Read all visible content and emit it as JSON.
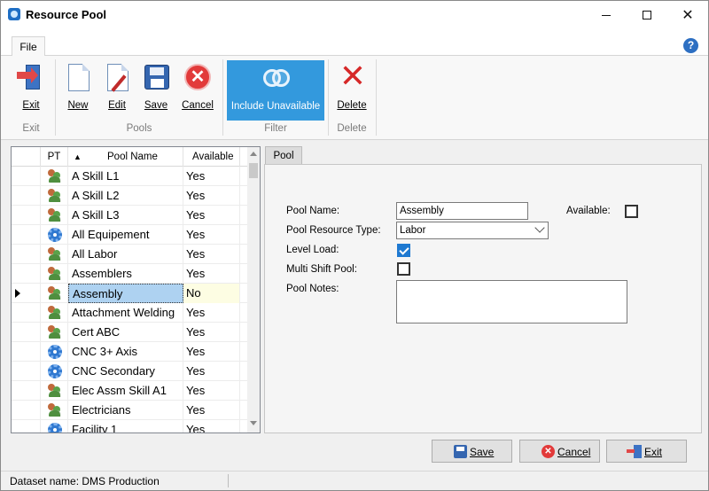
{
  "window": {
    "title": "Resource Pool"
  },
  "ribbon": {
    "tab": "File",
    "buttons": {
      "exit": "Exit",
      "new": "New",
      "edit": "Edit",
      "save": "Save",
      "cancel": "Cancel",
      "include_unavailable": "Include Unavailable",
      "delete": "Delete"
    },
    "groups": {
      "exit": "Exit",
      "pools": "Pools",
      "filter": "Filter",
      "delete": "Delete"
    }
  },
  "grid": {
    "headers": {
      "pt": "PT",
      "sort": "▲",
      "name": "Pool Name",
      "available": "Available"
    },
    "rows": [
      {
        "type": "people-icon",
        "name": "A Skill L1",
        "available": "Yes"
      },
      {
        "type": "people-icon",
        "name": "A Skill L2",
        "available": "Yes"
      },
      {
        "type": "people-icon",
        "name": "A Skill L3",
        "available": "Yes"
      },
      {
        "type": "gear-icon",
        "name": "All Equipement",
        "available": "Yes"
      },
      {
        "type": "people-icon",
        "name": "All Labor",
        "available": "Yes"
      },
      {
        "type": "people-icon",
        "name": "Assemblers",
        "available": "Yes"
      },
      {
        "type": "people-icon",
        "name": "Assembly",
        "available": "No",
        "selected": true
      },
      {
        "type": "people-icon",
        "name": "Attachment Welding",
        "available": "Yes"
      },
      {
        "type": "people-icon",
        "name": "Cert ABC",
        "available": "Yes"
      },
      {
        "type": "gear-icon",
        "name": "CNC 3+ Axis",
        "available": "Yes"
      },
      {
        "type": "gear-icon",
        "name": "CNC Secondary",
        "available": "Yes"
      },
      {
        "type": "people-icon",
        "name": "Elec Assm Skill A1",
        "available": "Yes"
      },
      {
        "type": "people-icon",
        "name": "Electricians",
        "available": "Yes"
      },
      {
        "type": "gear-icon",
        "name": "Facility 1",
        "available": "Yes"
      }
    ]
  },
  "detail": {
    "tab": "Pool",
    "labels": {
      "pool_name": "Pool Name:",
      "available": "Available:",
      "resource_type": "Pool Resource Type:",
      "level_load": "Level Load:",
      "multi_shift": "Multi Shift Pool:",
      "notes": "Pool Notes:"
    },
    "values": {
      "pool_name": "Assembly",
      "resource_type": "Labor",
      "available": false,
      "level_load": true,
      "multi_shift": false,
      "notes": ""
    }
  },
  "footer": {
    "save": "Save",
    "cancel": "Cancel",
    "exit": "Exit"
  },
  "status": {
    "dataset": "Dataset name:  DMS Production"
  }
}
